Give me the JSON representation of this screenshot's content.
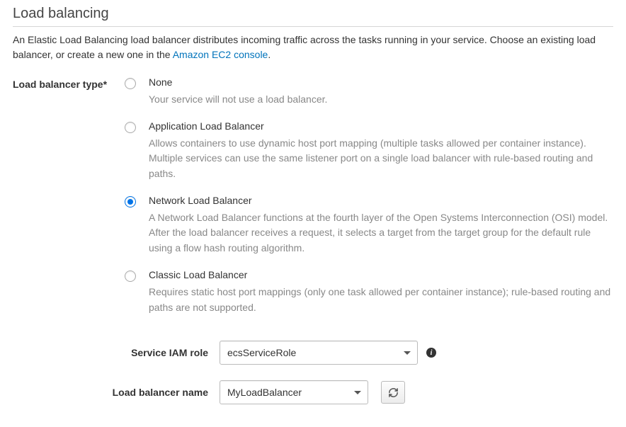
{
  "section": {
    "title": "Load balancing",
    "intro_pre": "An Elastic Load Balancing load balancer distributes incoming traffic across the tasks running in your service. Choose an existing load balancer, or create a new one in the ",
    "intro_link": "Amazon EC2 console",
    "intro_post": "."
  },
  "lb_type": {
    "label": "Load balancer type*",
    "selected": "nlb",
    "options": {
      "none": {
        "title": "None",
        "desc": "Your service will not use a load balancer."
      },
      "alb": {
        "title": "Application Load Balancer",
        "desc": "Allows containers to use dynamic host port mapping (multiple tasks allowed per container instance). Multiple services can use the same listener port on a single load balancer with rule-based routing and paths."
      },
      "nlb": {
        "title": "Network Load Balancer",
        "desc": "A Network Load Balancer functions at the fourth layer of the Open Systems Interconnection (OSI) model. After the load balancer receives a request, it selects a target from the target group for the default rule using a flow hash routing algorithm."
      },
      "clb": {
        "title": "Classic Load Balancer",
        "desc": "Requires static host port mappings (only one task allowed per container instance); rule-based routing and paths are not supported."
      }
    }
  },
  "iam_role": {
    "label": "Service IAM role",
    "value": "ecsServiceRole"
  },
  "lb_name": {
    "label": "Load balancer name",
    "value": "MyLoadBalancer"
  }
}
